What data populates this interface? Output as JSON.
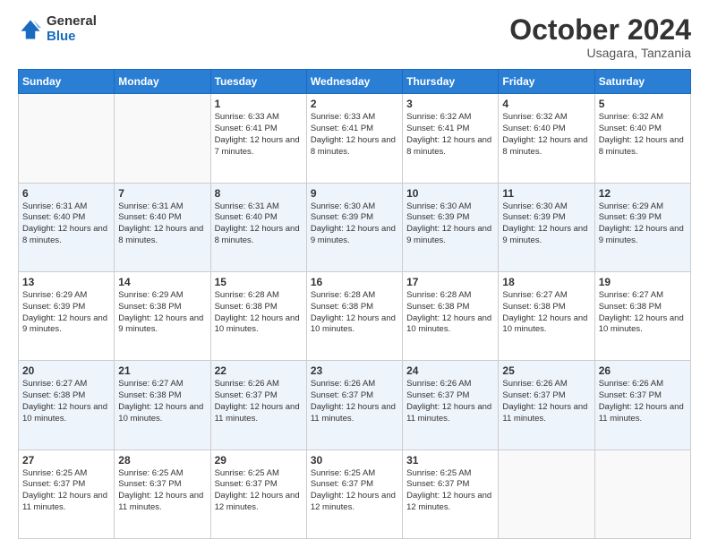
{
  "header": {
    "logo_general": "General",
    "logo_blue": "Blue",
    "month_title": "October 2024",
    "location": "Usagara, Tanzania"
  },
  "calendar": {
    "days_of_week": [
      "Sunday",
      "Monday",
      "Tuesday",
      "Wednesday",
      "Thursday",
      "Friday",
      "Saturday"
    ],
    "weeks": [
      [
        {
          "day": "",
          "info": ""
        },
        {
          "day": "",
          "info": ""
        },
        {
          "day": "1",
          "info": "Sunrise: 6:33 AM\nSunset: 6:41 PM\nDaylight: 12 hours and 7 minutes."
        },
        {
          "day": "2",
          "info": "Sunrise: 6:33 AM\nSunset: 6:41 PM\nDaylight: 12 hours and 8 minutes."
        },
        {
          "day": "3",
          "info": "Sunrise: 6:32 AM\nSunset: 6:41 PM\nDaylight: 12 hours and 8 minutes."
        },
        {
          "day": "4",
          "info": "Sunrise: 6:32 AM\nSunset: 6:40 PM\nDaylight: 12 hours and 8 minutes."
        },
        {
          "day": "5",
          "info": "Sunrise: 6:32 AM\nSunset: 6:40 PM\nDaylight: 12 hours and 8 minutes."
        }
      ],
      [
        {
          "day": "6",
          "info": "Sunrise: 6:31 AM\nSunset: 6:40 PM\nDaylight: 12 hours and 8 minutes."
        },
        {
          "day": "7",
          "info": "Sunrise: 6:31 AM\nSunset: 6:40 PM\nDaylight: 12 hours and 8 minutes."
        },
        {
          "day": "8",
          "info": "Sunrise: 6:31 AM\nSunset: 6:40 PM\nDaylight: 12 hours and 8 minutes."
        },
        {
          "day": "9",
          "info": "Sunrise: 6:30 AM\nSunset: 6:39 PM\nDaylight: 12 hours and 9 minutes."
        },
        {
          "day": "10",
          "info": "Sunrise: 6:30 AM\nSunset: 6:39 PM\nDaylight: 12 hours and 9 minutes."
        },
        {
          "day": "11",
          "info": "Sunrise: 6:30 AM\nSunset: 6:39 PM\nDaylight: 12 hours and 9 minutes."
        },
        {
          "day": "12",
          "info": "Sunrise: 6:29 AM\nSunset: 6:39 PM\nDaylight: 12 hours and 9 minutes."
        }
      ],
      [
        {
          "day": "13",
          "info": "Sunrise: 6:29 AM\nSunset: 6:39 PM\nDaylight: 12 hours and 9 minutes."
        },
        {
          "day": "14",
          "info": "Sunrise: 6:29 AM\nSunset: 6:38 PM\nDaylight: 12 hours and 9 minutes."
        },
        {
          "day": "15",
          "info": "Sunrise: 6:28 AM\nSunset: 6:38 PM\nDaylight: 12 hours and 10 minutes."
        },
        {
          "day": "16",
          "info": "Sunrise: 6:28 AM\nSunset: 6:38 PM\nDaylight: 12 hours and 10 minutes."
        },
        {
          "day": "17",
          "info": "Sunrise: 6:28 AM\nSunset: 6:38 PM\nDaylight: 12 hours and 10 minutes."
        },
        {
          "day": "18",
          "info": "Sunrise: 6:27 AM\nSunset: 6:38 PM\nDaylight: 12 hours and 10 minutes."
        },
        {
          "day": "19",
          "info": "Sunrise: 6:27 AM\nSunset: 6:38 PM\nDaylight: 12 hours and 10 minutes."
        }
      ],
      [
        {
          "day": "20",
          "info": "Sunrise: 6:27 AM\nSunset: 6:38 PM\nDaylight: 12 hours and 10 minutes."
        },
        {
          "day": "21",
          "info": "Sunrise: 6:27 AM\nSunset: 6:38 PM\nDaylight: 12 hours and 10 minutes."
        },
        {
          "day": "22",
          "info": "Sunrise: 6:26 AM\nSunset: 6:37 PM\nDaylight: 12 hours and 11 minutes."
        },
        {
          "day": "23",
          "info": "Sunrise: 6:26 AM\nSunset: 6:37 PM\nDaylight: 12 hours and 11 minutes."
        },
        {
          "day": "24",
          "info": "Sunrise: 6:26 AM\nSunset: 6:37 PM\nDaylight: 12 hours and 11 minutes."
        },
        {
          "day": "25",
          "info": "Sunrise: 6:26 AM\nSunset: 6:37 PM\nDaylight: 12 hours and 11 minutes."
        },
        {
          "day": "26",
          "info": "Sunrise: 6:26 AM\nSunset: 6:37 PM\nDaylight: 12 hours and 11 minutes."
        }
      ],
      [
        {
          "day": "27",
          "info": "Sunrise: 6:25 AM\nSunset: 6:37 PM\nDaylight: 12 hours and 11 minutes."
        },
        {
          "day": "28",
          "info": "Sunrise: 6:25 AM\nSunset: 6:37 PM\nDaylight: 12 hours and 11 minutes."
        },
        {
          "day": "29",
          "info": "Sunrise: 6:25 AM\nSunset: 6:37 PM\nDaylight: 12 hours and 12 minutes."
        },
        {
          "day": "30",
          "info": "Sunrise: 6:25 AM\nSunset: 6:37 PM\nDaylight: 12 hours and 12 minutes."
        },
        {
          "day": "31",
          "info": "Sunrise: 6:25 AM\nSunset: 6:37 PM\nDaylight: 12 hours and 12 minutes."
        },
        {
          "day": "",
          "info": ""
        },
        {
          "day": "",
          "info": ""
        }
      ]
    ]
  }
}
